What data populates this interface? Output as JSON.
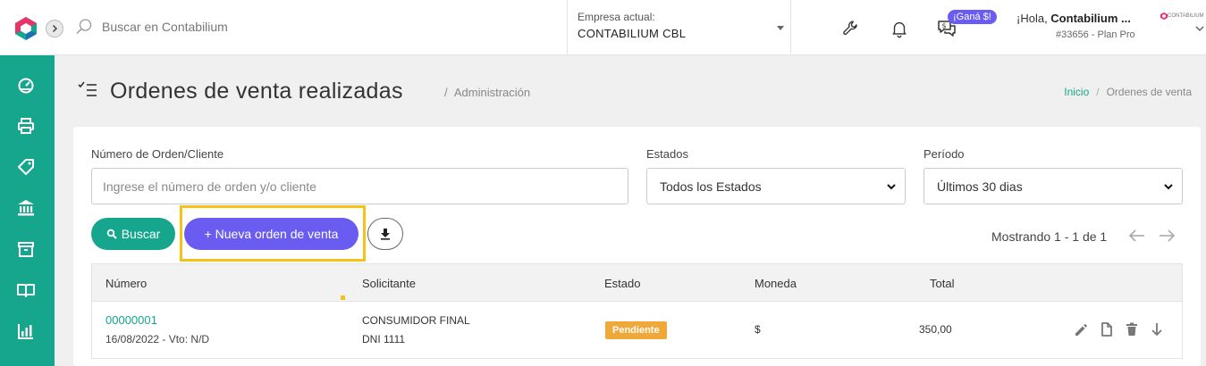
{
  "search": {
    "placeholder": "Buscar en Contabilium"
  },
  "company": {
    "label": "Empresa actual:",
    "name": "CONTABILIUM CBL"
  },
  "promo": {
    "label": "¡Ganá $!"
  },
  "user": {
    "greeting": "¡Hola, ",
    "name": "Contabilium ...",
    "plan": "#33656 - Plan Pro",
    "logo_text": "CONTABILIUM"
  },
  "page": {
    "title": "Ordenes de venta realizadas",
    "section": "Administración"
  },
  "breadcrumb": {
    "home": "Inicio",
    "separator": "/",
    "current": "Ordenes de venta"
  },
  "filters": {
    "order_label": "Número de Orden/Cliente",
    "order_placeholder": "Ingrese el número de orden y/o cliente",
    "status_label": "Estados",
    "status_value": "Todos los Estados",
    "period_label": "Período",
    "period_value": "Últimos 30 dias"
  },
  "actions": {
    "search": "Buscar",
    "new_order": "+ Nueva orden de venta"
  },
  "pagination": {
    "showing": "Mostrando 1 - 1 de 1"
  },
  "table": {
    "columns": [
      "Número",
      "Solicitante",
      "Estado",
      "Moneda",
      "Total"
    ],
    "rows": [
      {
        "number": "00000001",
        "date": "16/08/2022 - Vto: N/D",
        "client": "CONSUMIDOR FINAL",
        "doc": "DNI 1111",
        "status": "Pendiente",
        "currency": "$",
        "total": "350,00"
      }
    ]
  },
  "colors": {
    "accent": "#15a68d",
    "primary": "#6a5cf0",
    "highlight": "#f3c318",
    "pending": "#f0a838"
  },
  "icons": {
    "sidebar": [
      "dashboard-icon",
      "printer-icon",
      "tag-icon",
      "bank-icon",
      "box-icon",
      "book-icon",
      "chart-icon"
    ],
    "topbar": [
      "wrench-icon",
      "bell-icon",
      "money-chat-icon"
    ],
    "row": [
      "edit-icon",
      "copy-icon",
      "delete-icon",
      "arrow-down-icon"
    ]
  }
}
